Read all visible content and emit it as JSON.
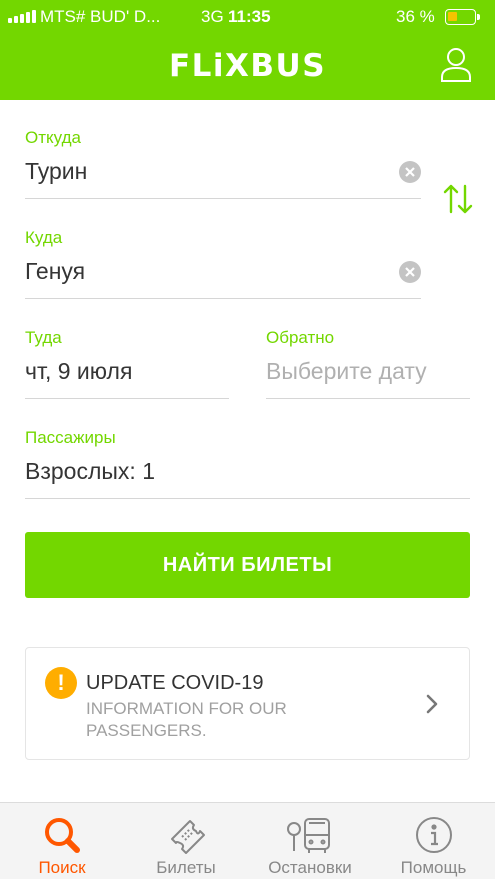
{
  "status_bar": {
    "carrier": "MTS# BUD' D...",
    "network": "3G",
    "time": "11:35",
    "battery": "36 %",
    "battery_level": 0.36
  },
  "header": {
    "logo": "FLiXBUS",
    "user_icon": "user-icon",
    "brand_color": "#73d700"
  },
  "form": {
    "from": {
      "label": "Откуда",
      "value": "Турин"
    },
    "to": {
      "label": "Куда",
      "value": "Генуя"
    },
    "depart": {
      "label": "Туда",
      "value": "чт, 9 июля"
    },
    "return": {
      "label": "Обратно",
      "placeholder": "Выберите дату"
    },
    "passengers": {
      "label": "Пассажиры",
      "value": "Взрослых: 1"
    },
    "search_button": "НАЙТИ БИЛЕТЫ"
  },
  "covid_card": {
    "title": "UPDATE COVID-19",
    "subtitle": "INFORMATION FOR OUR PASSENGERS.",
    "icon": "warning-icon",
    "accent": "#ffad00"
  },
  "tabs": [
    {
      "label": "Поиск",
      "icon": "search-icon",
      "active": true
    },
    {
      "label": "Билеты",
      "icon": "ticket-icon",
      "active": false
    },
    {
      "label": "Остановки",
      "icon": "bus-stop-icon",
      "active": false
    },
    {
      "label": "Помощь",
      "icon": "info-icon",
      "active": false
    }
  ],
  "colors": {
    "active_tab": "#ff5700",
    "inactive_tab": "#888888"
  }
}
